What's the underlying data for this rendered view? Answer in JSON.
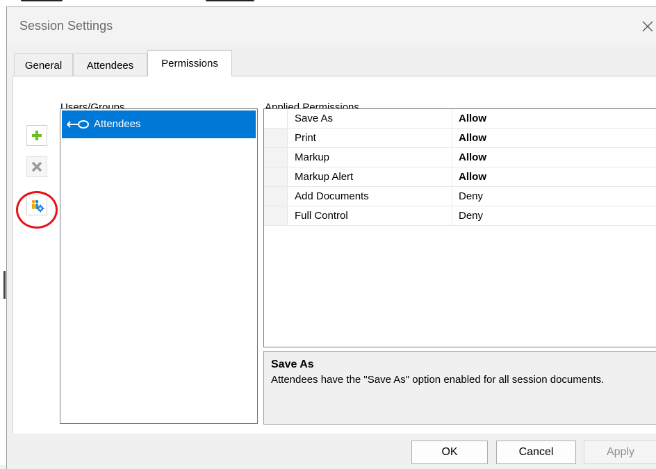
{
  "window": {
    "title": "Session Settings"
  },
  "tabs": [
    {
      "label": "General",
      "active": false
    },
    {
      "label": "Attendees",
      "active": false
    },
    {
      "label": "Permissions",
      "active": true
    }
  ],
  "users_groups": {
    "header": "Users/Groups",
    "items": [
      {
        "name": "Attendees",
        "icon": "key-icon",
        "selected": true
      }
    ],
    "actions": [
      {
        "name": "add-user-button",
        "icon": "plus-icon",
        "enabled": true
      },
      {
        "name": "remove-user-button",
        "icon": "x-icon",
        "enabled": false
      },
      {
        "name": "manage-groups-button",
        "icon": "users-gear-icon",
        "enabled": true,
        "highlighted": true
      }
    ]
  },
  "permissions": {
    "header": "Applied Permissions",
    "rows": [
      {
        "name": "Save As",
        "value": "Allow",
        "bold": true
      },
      {
        "name": "Print",
        "value": "Allow",
        "bold": true
      },
      {
        "name": "Markup",
        "value": "Allow",
        "bold": true
      },
      {
        "name": "Markup Alert",
        "value": "Allow",
        "bold": true
      },
      {
        "name": "Add Documents",
        "value": "Deny",
        "bold": false
      },
      {
        "name": "Full Control",
        "value": "Deny",
        "bold": false
      }
    ]
  },
  "description": {
    "title": "Save As",
    "text": "Attendees have the \"Save As\" option enabled for all session documents."
  },
  "buttons": {
    "ok": "OK",
    "cancel": "Cancel",
    "apply": "Apply"
  },
  "colors": {
    "selection": "#0078d7",
    "highlight_ring": "#e3141b",
    "plus": "#6cbf2a"
  }
}
